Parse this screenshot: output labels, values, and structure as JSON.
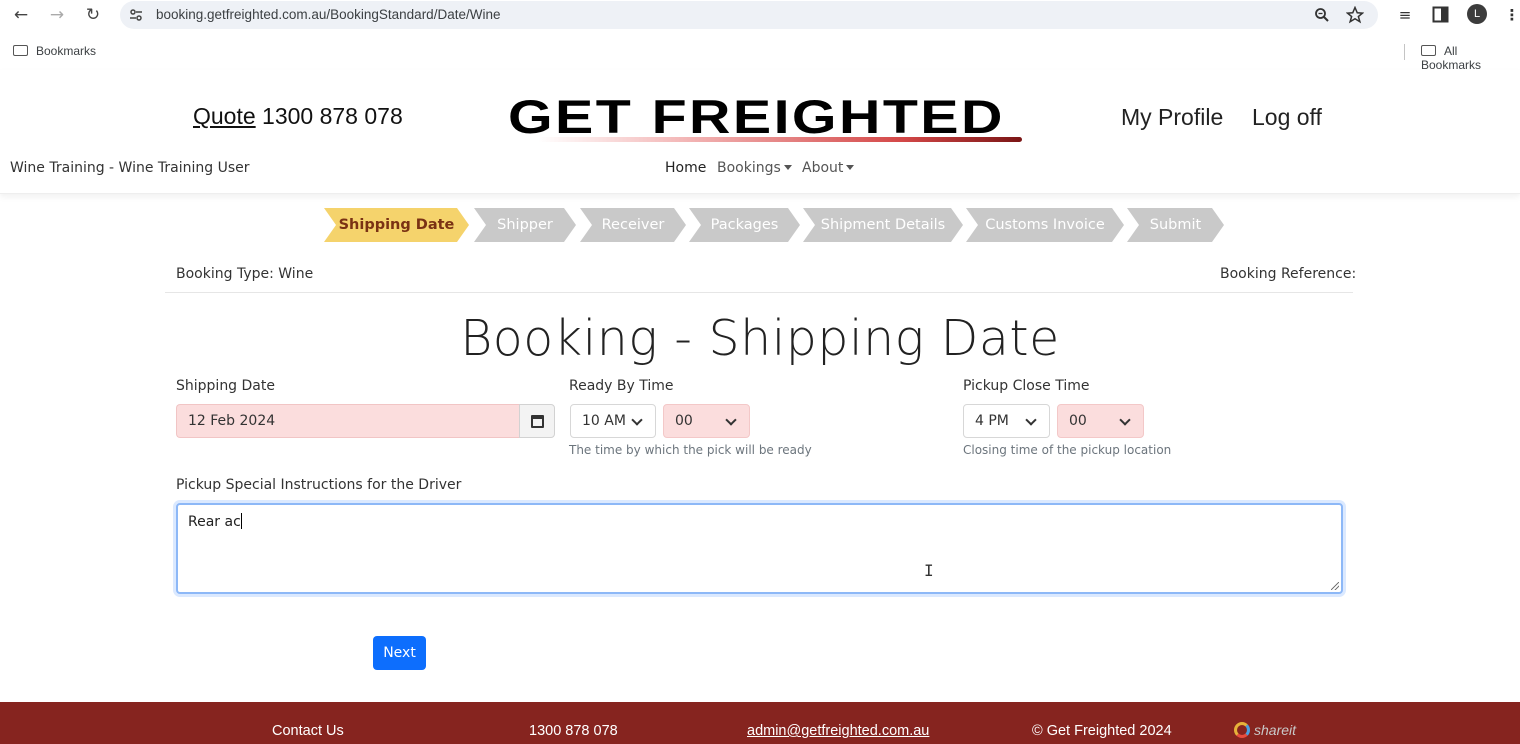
{
  "browser": {
    "url": "booking.getfreighted.com.au/BookingStandard/Date/Wine",
    "bookmarks_label": "Bookmarks",
    "all_bookmarks_label": "All Bookmarks",
    "avatar_letter": "L"
  },
  "header": {
    "quote_link": "Quote",
    "phone": "1300 878 078",
    "logo_text": "GET FREIGHTED",
    "my_profile": "My Profile",
    "log_off": "Log off",
    "user": "Wine Training - Wine Training User",
    "nav": {
      "home": "Home",
      "bookings": "Bookings",
      "about": "About"
    }
  },
  "steps": [
    "Shipping Date",
    "Shipper",
    "Receiver",
    "Packages",
    "Shipment Details",
    "Customs Invoice",
    "Submit"
  ],
  "active_step": "Shipping Date",
  "booking": {
    "type_label": "Booking Type: Wine",
    "reference_label": "Booking Reference:",
    "page_title": "Booking - Shipping Date"
  },
  "form": {
    "shipping_date_label": "Shipping Date",
    "shipping_date_value": "12 Feb 2024",
    "ready_by_label": "Ready By Time",
    "ready_hour": "10 AM",
    "ready_minute": "00",
    "ready_help": "The time by which the pick will be ready",
    "pickup_close_label": "Pickup Close Time",
    "close_hour": "4 PM",
    "close_minute": "00",
    "close_help": "Closing time of the pickup location",
    "instructions_label": "Pickup Special Instructions for the Driver",
    "instructions_value": "Rear ac",
    "next_button": "Next"
  },
  "footer": {
    "contact": "Contact Us",
    "phone": "1300 878 078",
    "email": "admin@getfreighted.com.au",
    "copyright": "© Get Freighted 2024",
    "shareit": "shareit"
  },
  "colors": {
    "active_step": "#f5d36c",
    "inactive_step": "#c9c9c9",
    "primary_button": "#0d6efd",
    "footer": "#86241f",
    "invalid_field": "#fbdddd"
  }
}
